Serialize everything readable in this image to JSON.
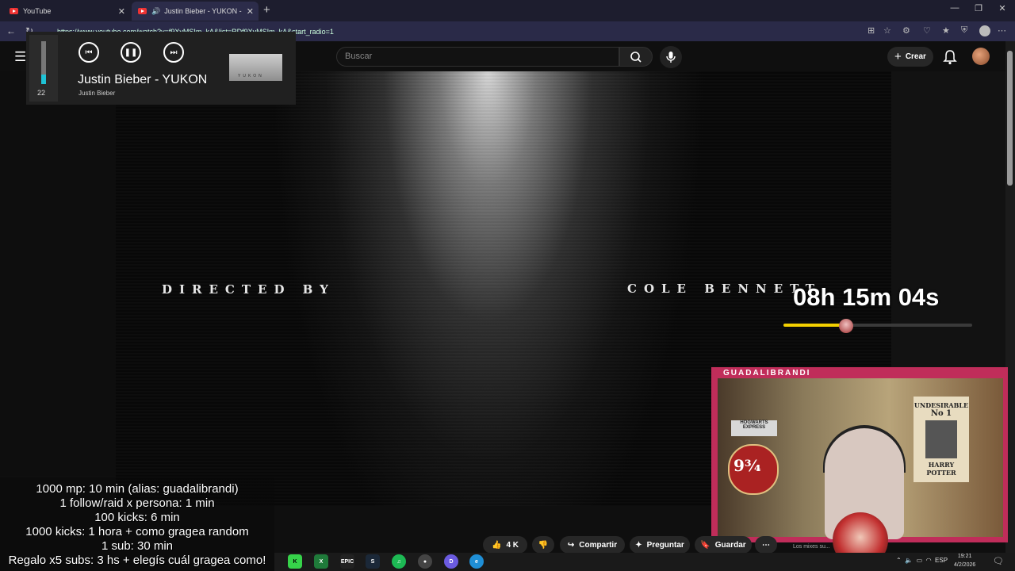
{
  "browser": {
    "tabs": [
      {
        "label": "YouTube"
      },
      {
        "label": "Justin Bieber - YUKON - YouTube"
      }
    ],
    "url": "https://www.youtube.com/watch?v=f9XyMSIm_kA&list=RDf9XyMSIm_kA&start_radio=1"
  },
  "youtube": {
    "search_placeholder": "Buscar",
    "create_label": "Crear"
  },
  "video": {
    "credit_left": "DIRECTED BY",
    "credit_right": "COLE BENNETT"
  },
  "media_overlay": {
    "volume": 22,
    "volume_label": "22",
    "title": "Justin Bieber - YUKON",
    "artist": "Justin Bieber",
    "thumb_text": "YUKON"
  },
  "timer": {
    "text": "08h 15m 04s",
    "progress": 0.33
  },
  "cam": {
    "streamer": "GUADALIBRANDI",
    "poster_title": "UNDESIRABLE",
    "poster_no": "No 1",
    "poster_name": "HARRY POTTER",
    "hogwarts": "HOGWARTS EXPRESS",
    "platform": "9¾"
  },
  "subathon": [
    "1000 mp: 10 min (alias: guadalibrandi)",
    "1 follow/raid x persona: 1 min",
    "100 kicks: 6 min",
    "1000 kicks: 1 hora + como gragea random",
    "1 sub: 30 min",
    "Regalo x5 subs: 3 hs + elegís cuál gragea como!"
  ],
  "actions": {
    "likes": "4 K",
    "share": "Compartir",
    "ask": "Preguntar",
    "save": "Guardar",
    "desc_snippet": "Los mixes su..."
  },
  "taskbar": {
    "lang": "ESP",
    "time": "19:21",
    "date": "4/2/2026"
  }
}
